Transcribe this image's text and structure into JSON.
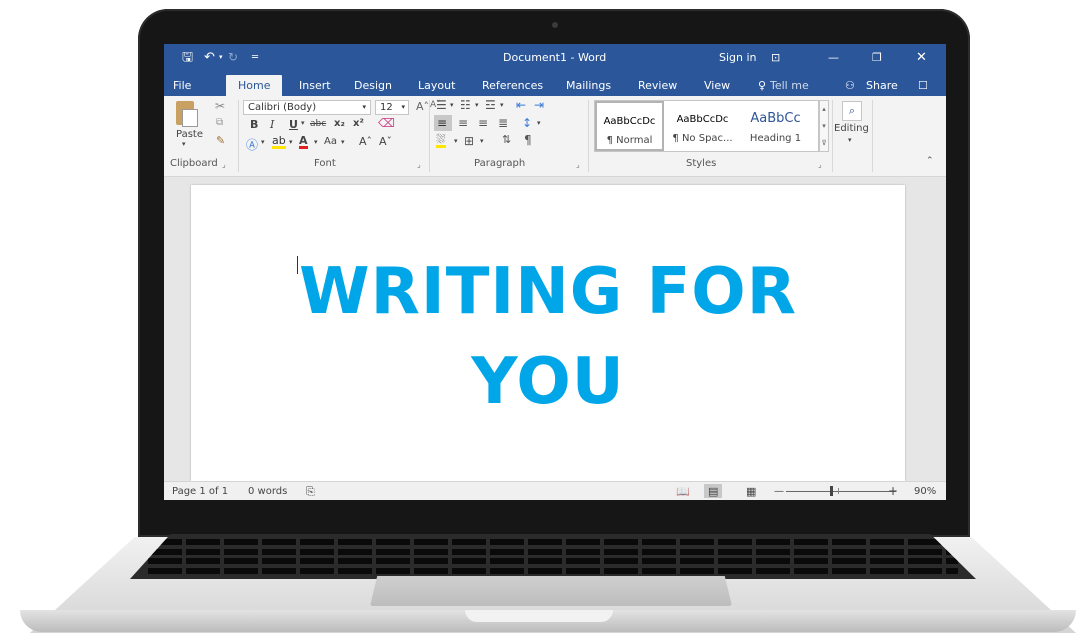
{
  "window": {
    "title": "Document1  -  Word",
    "sign_in": "Sign in",
    "icons": [
      "save-icon",
      "undo-icon",
      "redo-icon",
      "customize-icon",
      "ribbon-display-icon",
      "minimize-icon",
      "restore-icon",
      "close-icon"
    ]
  },
  "tabs": [
    "File",
    "Home",
    "Insert",
    "Design",
    "Layout",
    "References",
    "Mailings",
    "Review",
    "View"
  ],
  "active_tab": "Home",
  "tell_me": "Tell me",
  "share": "Share",
  "ribbon": {
    "clipboard": {
      "label": "Clipboard",
      "paste": "Paste"
    },
    "font": {
      "label": "Font",
      "font_name": "Calibri (Body)",
      "font_size": "12",
      "bold": "B",
      "italic": "I",
      "underline": "U",
      "strike": "abc",
      "subscript": "x₂",
      "superscript": "x²",
      "change_case": "Aa",
      "grow": "A˄",
      "shrink": "A˅"
    },
    "paragraph": {
      "label": "Paragraph"
    },
    "styles": {
      "label": "Styles",
      "items": [
        {
          "preview": "AaBbCcDc",
          "name": "¶ Normal"
        },
        {
          "preview": "AaBbCcDc",
          "name": "¶ No Spac..."
        },
        {
          "preview": "AaBbCc",
          "name": "Heading 1"
        }
      ]
    },
    "editing": {
      "label": "Editing"
    }
  },
  "document": {
    "line1": "WRITING FOR",
    "line2": "YOU",
    "text_color": "#00a6e8"
  },
  "status": {
    "page": "Page 1 of 1",
    "words": "0 words",
    "zoom": "90%",
    "zoom_minus": "—",
    "zoom_plus": "+"
  },
  "colors": {
    "accent": "#2b579a",
    "ribbon_bg": "#f3f3f3",
    "heading": "#00a6e8"
  }
}
